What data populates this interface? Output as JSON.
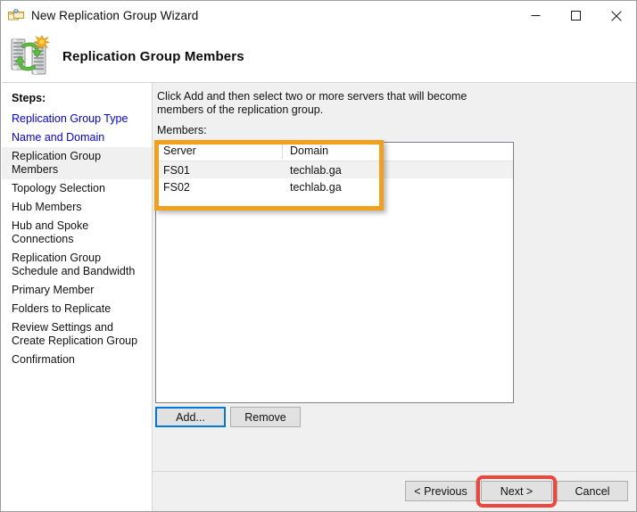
{
  "window": {
    "title": "New Replication Group Wizard",
    "icon": "folder-replication-icon",
    "controls": {
      "minimize": "minimize-icon",
      "maximize": "maximize-icon",
      "close": "close-icon"
    }
  },
  "header": {
    "title": "Replication Group Members",
    "icon": "server-replication-icon"
  },
  "sidebar": {
    "label": "Steps:",
    "items": [
      {
        "label": "Replication Group Type",
        "state": "link"
      },
      {
        "label": "Name and Domain",
        "state": "link"
      },
      {
        "label": "Replication Group Members",
        "state": "current"
      },
      {
        "label": "Topology Selection",
        "state": "pending"
      },
      {
        "label": "Hub Members",
        "state": "pending"
      },
      {
        "label": "Hub and Spoke Connections",
        "state": "pending"
      },
      {
        "label": "Replication Group Schedule and Bandwidth",
        "state": "pending"
      },
      {
        "label": "Primary Member",
        "state": "pending"
      },
      {
        "label": "Folders to Replicate",
        "state": "pending"
      },
      {
        "label": "Review Settings and Create Replication Group",
        "state": "pending"
      },
      {
        "label": "Confirmation",
        "state": "pending"
      }
    ]
  },
  "main": {
    "instruction": "Click Add and then select two or more servers that will become members of the replication group.",
    "members_label": "Members:",
    "table": {
      "columns": [
        "Server",
        "Domain"
      ],
      "rows": [
        {
          "server": "FS01",
          "domain": "techlab.ga"
        },
        {
          "server": "FS02",
          "domain": "techlab.ga"
        }
      ]
    },
    "buttons": {
      "add": "Add...",
      "remove": "Remove"
    }
  },
  "footer": {
    "previous": "< Previous",
    "next": "Next >",
    "cancel": "Cancel"
  },
  "annotations": {
    "orange_highlight_color": "#f0a01c",
    "red_highlight_color": "#f0453c",
    "focus_color": "#0078d7"
  }
}
